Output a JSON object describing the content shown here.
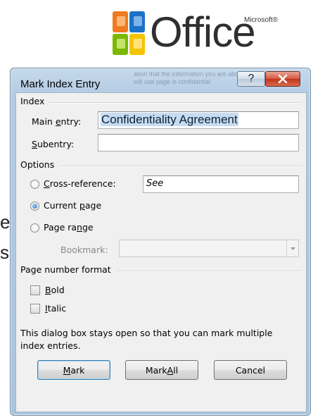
{
  "logo": {
    "word": "Office",
    "brand": "Microsoft®",
    "colors": {
      "orange": "#f07a1c",
      "green": "#7ab800",
      "blue": "#1c72c8",
      "yellow": "#f5c400"
    }
  },
  "background_fragments": [
    "e",
    "s"
  ],
  "dialog": {
    "title": "Mark Index Entry",
    "ghost_text": "ation that the information you are about to enter will use page is confidential",
    "help_label": "?",
    "index_section": "Index",
    "main_entry": {
      "label_pre": "Main ",
      "label_key": "e",
      "label_post": "ntry:",
      "value": "Confidentiality Agreement"
    },
    "subentry": {
      "label_key": "S",
      "label_post": "ubentry:",
      "value": ""
    },
    "options_section": "Options",
    "cross_reference": {
      "label_key": "C",
      "label_post": "ross-reference:",
      "value": "See"
    },
    "current_page": {
      "label_pre": "Current ",
      "label_key": "p",
      "label_post": "age",
      "selected": true
    },
    "page_range": {
      "label_pre": "Page ra",
      "label_key": "n",
      "label_post": "ge"
    },
    "bookmark": {
      "label": "Bookmark:",
      "value": ""
    },
    "page_number_section": "Page number format",
    "bold": {
      "label_key": "B",
      "label_post": "old",
      "checked": false
    },
    "italic": {
      "label_key": "I",
      "label_post": "talic",
      "checked": false
    },
    "info": "This dialog box stays open so that you can mark multiple index entries.",
    "buttons": {
      "mark": {
        "label_key": "M",
        "label_post": "ark"
      },
      "mark_all": {
        "label_pre": "Mark ",
        "label_key": "A",
        "label_post": "ll"
      },
      "cancel": "Cancel"
    }
  }
}
